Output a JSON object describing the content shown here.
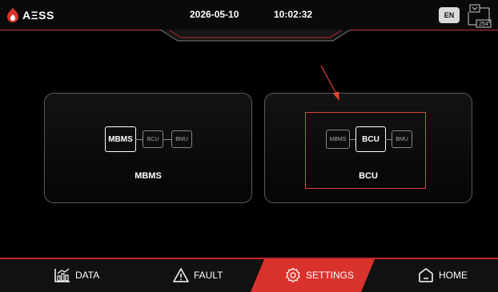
{
  "header": {
    "logo_text": "AΞSS",
    "date": "2026-05-10",
    "time": "10:02:32",
    "lang": "EN",
    "net_number": "254"
  },
  "cards": [
    {
      "title": "MBMS",
      "boxes": [
        "MBMS",
        "BCU",
        "BMU"
      ],
      "active_index": 0
    },
    {
      "title": "BCU",
      "boxes": [
        "MBMS",
        "BCU",
        "BMU"
      ],
      "active_index": 1
    }
  ],
  "footer": {
    "data_label": "DATA",
    "fault_label": "FAULT",
    "settings_label": "SETTINGS",
    "home_label": "HOME",
    "active": "settings"
  },
  "colors": {
    "accent": "#c0282d",
    "highlight": "#e0453a"
  }
}
